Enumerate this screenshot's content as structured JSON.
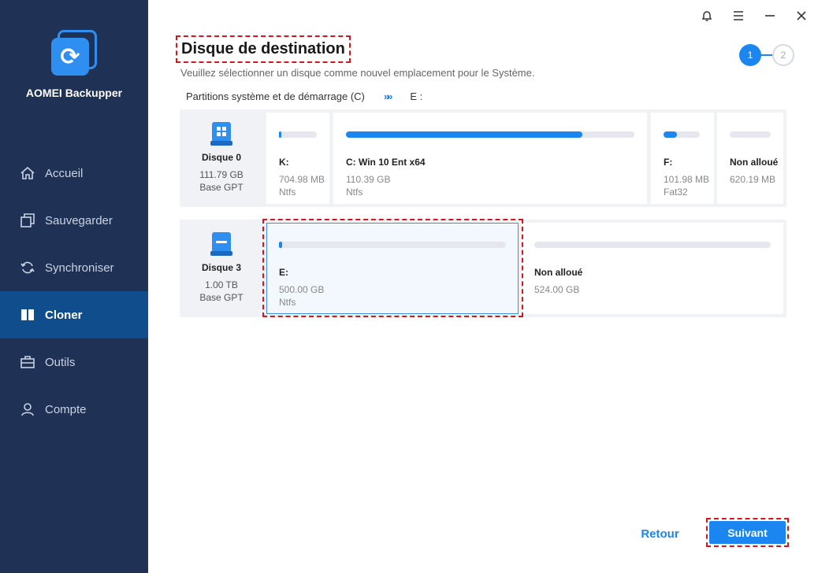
{
  "app": {
    "brand": "AOMEI Backupper"
  },
  "sidebar": {
    "items": [
      {
        "label": "Accueil",
        "icon": "home-icon"
      },
      {
        "label": "Sauvegarder",
        "icon": "backup-icon"
      },
      {
        "label": "Synchroniser",
        "icon": "sync-icon"
      },
      {
        "label": "Cloner",
        "icon": "clone-icon",
        "active": true
      },
      {
        "label": "Outils",
        "icon": "tools-icon"
      },
      {
        "label": "Compte",
        "icon": "user-icon"
      }
    ]
  },
  "header": {
    "title": "Disque de destination",
    "subtitle": "Veuillez sélectionner un disque comme nouvel emplacement pour le Système.",
    "steps": [
      "1",
      "2"
    ],
    "current_step": 1
  },
  "crumbs": {
    "source": "Partitions système et de démarrage (C)",
    "arrow": "»»",
    "target": "E :"
  },
  "disks": [
    {
      "name": "Disque 0",
      "size": "111.79 GB",
      "type": "Base GPT",
      "partitions": [
        {
          "label": "K:",
          "size": "704.98 MB",
          "fs": "Ntfs",
          "used": 0.05
        },
        {
          "label": "C: Win 10 Ent x64",
          "size": "110.39 GB",
          "fs": "Ntfs",
          "used": 0.82
        },
        {
          "label": "F:",
          "size": "101.98 MB",
          "fs": "Fat32",
          "used": 0.38
        },
        {
          "label": "Non alloué",
          "size": "620.19 MB",
          "fs": "",
          "used": 0
        }
      ]
    },
    {
      "name": "Disque 3",
      "size": "1.00 TB",
      "type": "Base GPT",
      "partitions": [
        {
          "label": "E:",
          "size": "500.00 GB",
          "fs": "Ntfs",
          "used": 0.01,
          "selected": true
        },
        {
          "label": "Non alloué",
          "size": "524.00 GB",
          "fs": "",
          "used": 0
        }
      ]
    }
  ],
  "buttons": {
    "back": "Retour",
    "next": "Suivant"
  },
  "colors": {
    "accent": "#1b86f0",
    "sidebar": "#1f3155",
    "highlight": "#d9141b"
  }
}
